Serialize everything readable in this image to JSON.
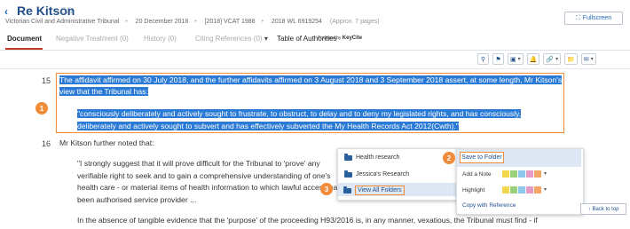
{
  "header": {
    "back_glyph": "‹",
    "title": "Re Kitson",
    "title_icon": "✎⃝",
    "meta": [
      "Victorian Civil and Administrative Tribunal",
      "20 December 2018",
      "[2018] VCAT 1988",
      "2018 WL 6919254"
    ],
    "meta_sep": "•",
    "pages": "(Approx. 7 pages)",
    "fullscreen_label": "Fullscreen"
  },
  "tabs": [
    {
      "label": "Document"
    },
    {
      "label": "Negative Treatment (0)"
    },
    {
      "label": "History (0)"
    },
    {
      "label": "Citing References (0)"
    },
    {
      "label": "Table of Authorities"
    }
  ],
  "powered_by": "Powered by",
  "keycite": "KeyCite",
  "toolbar": [
    "search-icon",
    "filter-icon",
    "note-icon",
    "alert-icon",
    "link-icon",
    "folder-icon",
    "email-icon"
  ],
  "para15": {
    "number": "15",
    "text": "The affidavit affirmed on 30 July 2018, and the further affidavits affirmed on 3 August 2018 and 3 September 2018 assert, at some length, Mr Kitson's view that the Tribunal has:",
    "quote": "\"consciously deliberately and actively sought to frustrate, to obstruct, to delay and to deny my legislated rights, and has consciously, deliberately and actively sought to subvert and has effectively subverted the My Health Records Act 2012(Cwth).\""
  },
  "para16": {
    "number": "16",
    "text": "Mr Kitson further noted that:",
    "quote": "\"I strongly suggest that it will prove difficult for the Tribunal to 'prove' any verifiable right to seek and to gain a comprehensive understanding of one's health care - or material items of health information to which lawful access has been authorised service provider ..."
  },
  "bottom_text": "In the absence of tangible evidence that the 'purpose' of the proceeding H93/2016 is, in any manner, vexatious, the Tribunal must find - if",
  "badges": [
    "1",
    "2",
    "3"
  ],
  "folder_menu": {
    "items": [
      "Health research",
      "Jessica's Research",
      "View All Folders"
    ]
  },
  "action_menu": {
    "save_to_folder": "Save to Folder",
    "add_note": "Add a Note",
    "highlight": "Highlight",
    "copy_ref": "Copy with Reference",
    "note_colors": [
      "#f2d64b",
      "#9ad07a",
      "#8fc8ea",
      "#e79ac4",
      "#f3a86a"
    ],
    "highlight_colors": [
      "#f2d64b",
      "#9ad07a",
      "#8fc8ea",
      "#e79ac4",
      "#f3a86a"
    ]
  },
  "back_to_top": "Back to top",
  "colors": {
    "accent": "#1f66b0",
    "selection": "#2b7bd6",
    "callout": "#f08c3a"
  }
}
